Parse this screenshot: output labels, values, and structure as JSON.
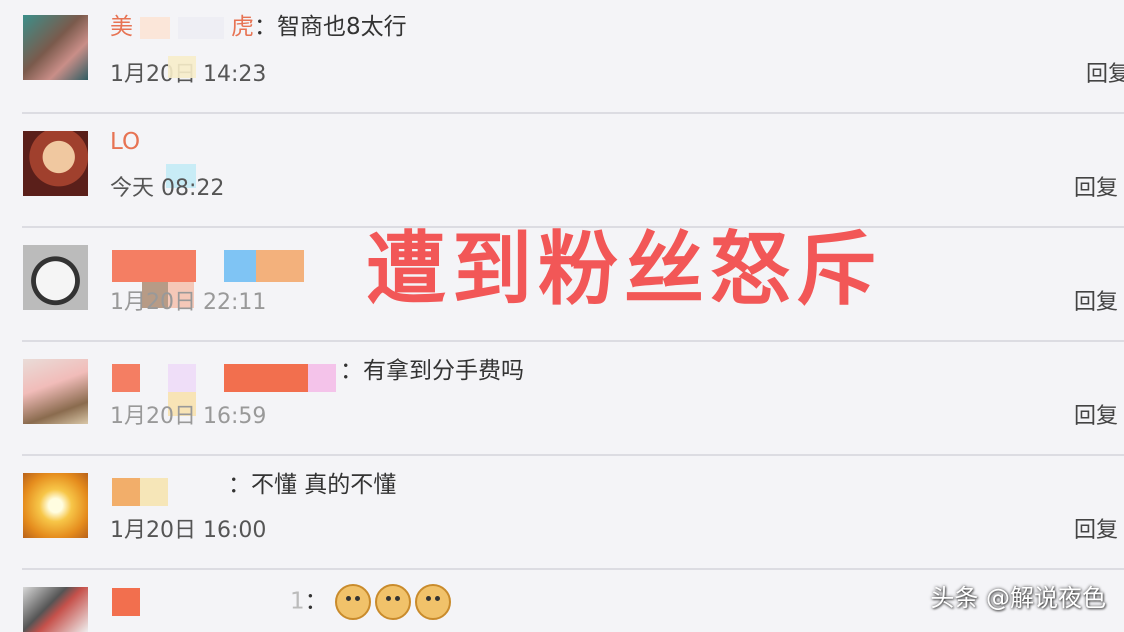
{
  "comments": [
    {
      "username": "美",
      "username_tail": "虎",
      "separator": "：",
      "text": "智商也8太行",
      "date": "1月20日 14:23",
      "reply": "回复"
    },
    {
      "username": "LO",
      "username_tail": "",
      "separator": "",
      "text": "",
      "date": "今天 08:22",
      "reply": "回复"
    },
    {
      "username": "",
      "username_tail": "",
      "separator": "",
      "text": "",
      "date": "1月20日 22:11",
      "reply": "回复"
    },
    {
      "username": "",
      "username_tail": "",
      "separator": "：",
      "text": "有拿到分手费吗",
      "date": "1月20日 16:59",
      "reply": "回复"
    },
    {
      "username": "",
      "username_tail": "",
      "separator": "：",
      "text": "不懂 真的不懂",
      "date": "1月20日 16:00",
      "reply": "回复"
    },
    {
      "username": "",
      "username_tail": "1",
      "separator": "：",
      "text": "",
      "date": "",
      "reply": ""
    }
  ],
  "overlay_title": "遭到粉丝怒斥",
  "watermark": "头条 @解说夜色",
  "colors": {
    "accent_red": "#f25757",
    "username_orange": "#e77353"
  },
  "icons": [
    "doge-emoji",
    "doge-emoji",
    "doge-emoji"
  ]
}
